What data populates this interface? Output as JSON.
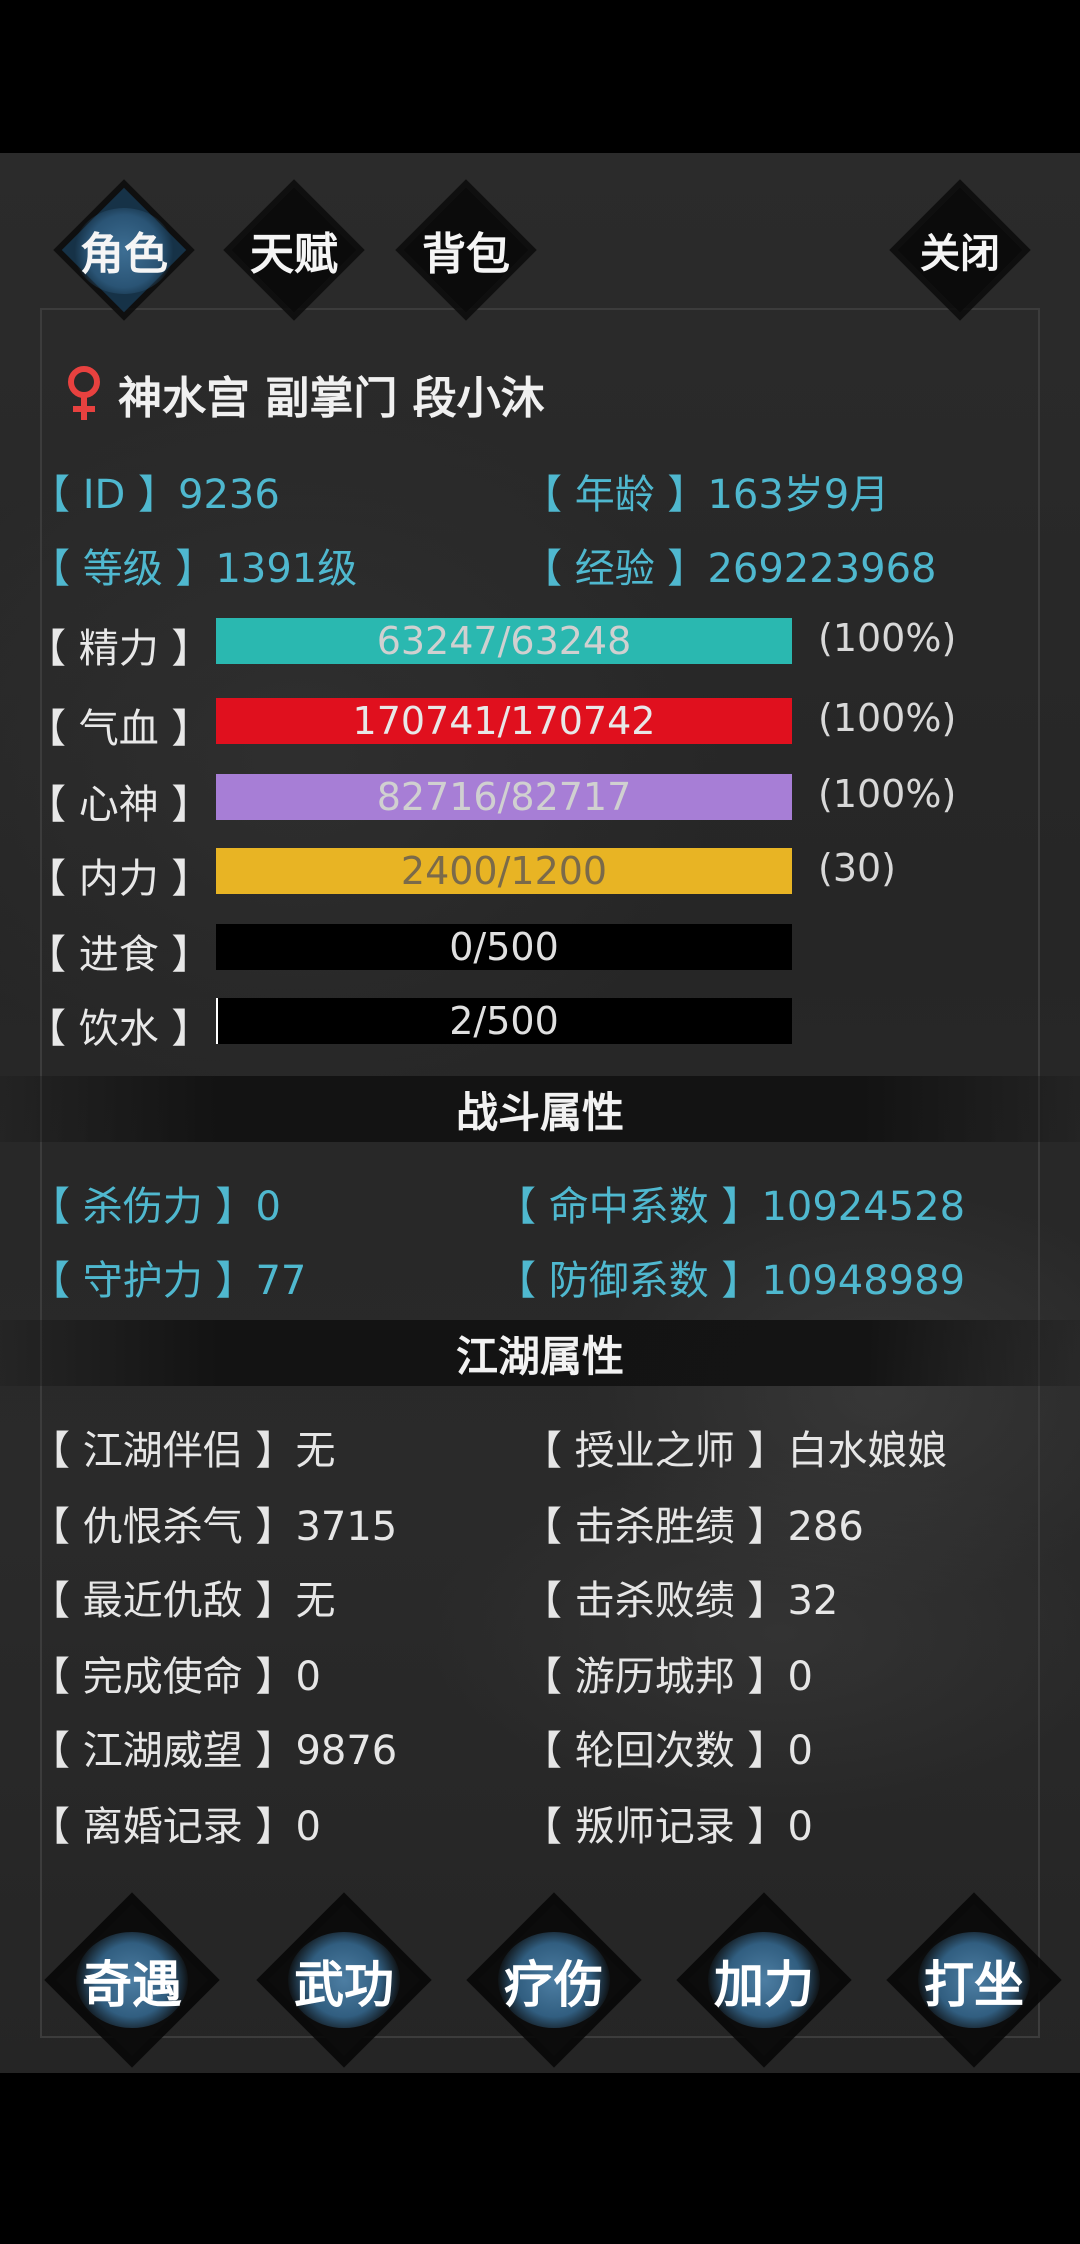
{
  "tabs": [
    {
      "label": "角色",
      "active": true
    },
    {
      "label": "天赋",
      "active": false
    },
    {
      "label": "背包",
      "active": false
    }
  ],
  "close_label": "关闭",
  "character": {
    "gender_icon": "female-icon",
    "gender_color": "#e8413f",
    "title": "神水宫 副掌门 段小沐"
  },
  "info": {
    "id_label": "【 ID 】",
    "id_value": "9236",
    "age_label": "【 年龄 】",
    "age_value": "163岁9月",
    "level_label": "【 等级 】",
    "level_value": "1391级",
    "exp_label": "【 经验 】",
    "exp_value": "269223968"
  },
  "bars": [
    {
      "label": "【 精力 】",
      "text": "63247/63248",
      "fill": 1.0,
      "color": "#2ab8b0",
      "text_color": "#d0d0d0",
      "suffix": "(100%)"
    },
    {
      "label": "【 气血 】",
      "text": "170741/170742",
      "fill": 1.0,
      "color": "#e0101e",
      "text_color": "#e8e8e8",
      "suffix": "(100%)"
    },
    {
      "label": "【 心神 】",
      "text": "82716/82717",
      "fill": 1.0,
      "color": "#a77ed6",
      "text_color": "#d0d0d0",
      "suffix": "(100%)"
    },
    {
      "label": "【 内力 】",
      "text": "2400/1200",
      "fill": 1.0,
      "color": "#e8b424",
      "text_color": "#7a6a4a",
      "suffix": "(30)"
    },
    {
      "label": "【 进食 】",
      "text": "0/500",
      "fill": 0.0,
      "color": "#000000",
      "text_color": "#e0e0e0",
      "suffix": ""
    },
    {
      "label": "【 饮水 】",
      "text": "2/500",
      "fill": 0.004,
      "color": "#ffffff",
      "text_color": "#e0e0e0",
      "suffix": ""
    }
  ],
  "combat": {
    "title": "战斗属性",
    "kill_label": "【 杀伤力 】",
    "kill_value": "0",
    "hit_label": "【 命中系数 】",
    "hit_value": "10924528",
    "guard_label": "【 守护力 】",
    "guard_value": "77",
    "def_label": "【 防御系数 】",
    "def_value": "10948989"
  },
  "jianghu": {
    "title": "江湖属性",
    "left": [
      {
        "label": "【 江湖伴侣 】",
        "value": "无"
      },
      {
        "label": "【 仇恨杀气 】",
        "value": "3715"
      },
      {
        "label": "【 最近仇敌 】",
        "value": "无"
      },
      {
        "label": "【 完成使命 】",
        "value": "0"
      },
      {
        "label": "【 江湖威望 】",
        "value": "9876"
      },
      {
        "label": "【 离婚记录 】",
        "value": "0"
      }
    ],
    "right": [
      {
        "label": "【 授业之师 】",
        "value": "白水娘娘"
      },
      {
        "label": "【 击杀胜绩 】",
        "value": "286"
      },
      {
        "label": "【 击杀败绩 】",
        "value": "32"
      },
      {
        "label": "【 游历城邦 】",
        "value": "0"
      },
      {
        "label": "【 轮回次数 】",
        "value": "0"
      },
      {
        "label": "【 叛师记录 】",
        "value": "0"
      }
    ]
  },
  "actions": [
    "奇遇",
    "武功",
    "疗伤",
    "加力",
    "打坐"
  ]
}
